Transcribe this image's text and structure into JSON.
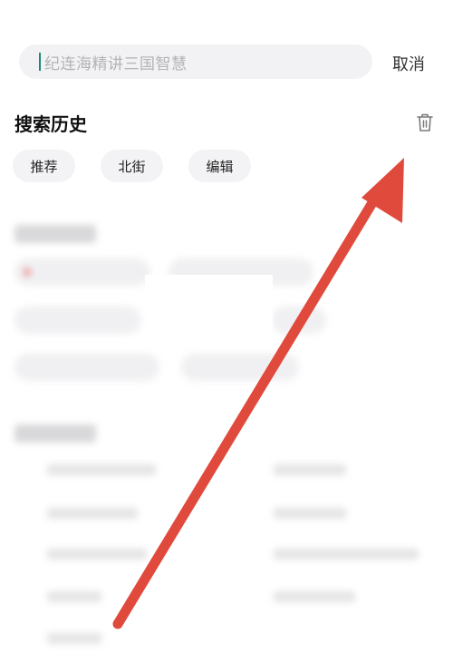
{
  "search": {
    "placeholder": "纪连海精讲三国智慧",
    "cancel_label": "取消"
  },
  "history": {
    "title": "搜索历史",
    "chips": [
      "推荐",
      "北街",
      "编辑"
    ]
  },
  "colors": {
    "accent_caret": "#1a8a7a",
    "annotation_arrow": "#e04a3c"
  }
}
